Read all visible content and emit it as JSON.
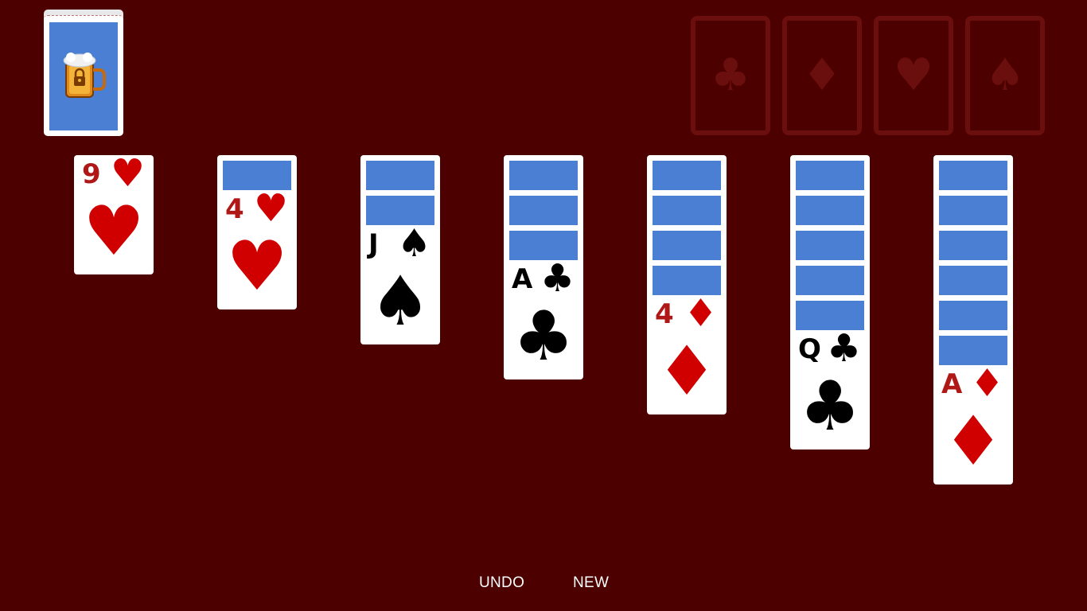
{
  "stock": {
    "icon": "locked-beer-mug-icon"
  },
  "foundations": [
    {
      "suit": "clubs",
      "symbol": "♣"
    },
    {
      "suit": "diamonds",
      "symbol": "♦"
    },
    {
      "suit": "hearts",
      "symbol": "♥"
    },
    {
      "suit": "spades",
      "symbol": "♠"
    }
  ],
  "tableau": [
    {
      "face_down": 0,
      "top": {
        "rank": "9",
        "suit": "♥",
        "color": "red"
      }
    },
    {
      "face_down": 1,
      "top": {
        "rank": "4",
        "suit": "♥",
        "color": "red"
      }
    },
    {
      "face_down": 2,
      "top": {
        "rank": "J",
        "suit": "♠",
        "color": "black"
      }
    },
    {
      "face_down": 3,
      "top": {
        "rank": "A",
        "suit": "♣",
        "color": "black"
      }
    },
    {
      "face_down": 4,
      "top": {
        "rank": "4",
        "suit": "♦",
        "color": "red"
      }
    },
    {
      "face_down": 5,
      "top": {
        "rank": "Q",
        "suit": "♣",
        "color": "black"
      }
    },
    {
      "face_down": 6,
      "top": {
        "rank": "A",
        "suit": "♦",
        "color": "red"
      }
    }
  ],
  "controls": {
    "undo_label": "UNDO",
    "new_label": "NEW"
  },
  "colors": {
    "felt": "#4d0000",
    "card_back": "#4a7fd4",
    "red_suit": "#d10000",
    "foundation_outline": "#6b0e0e"
  }
}
